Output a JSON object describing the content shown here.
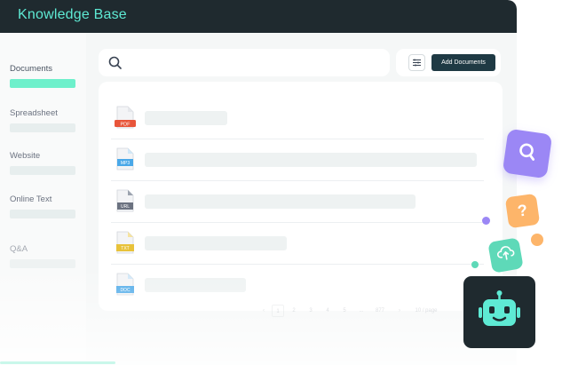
{
  "app": {
    "title": "Knowledge Base"
  },
  "sidebar": {
    "items": [
      {
        "label": "Documents",
        "active": true
      },
      {
        "label": "Spreadsheet",
        "active": false
      },
      {
        "label": "Website",
        "active": false
      },
      {
        "label": "Online Text",
        "active": false
      },
      {
        "label": "Q&A",
        "active": false
      }
    ]
  },
  "search": {
    "icon": "search-icon"
  },
  "toolbar": {
    "filter_icon": "filter-icon",
    "add_label": "Add Documents"
  },
  "documents": [
    {
      "type": "pdf",
      "label": "PDF",
      "color": "#e8553a"
    },
    {
      "type": "mp3",
      "label": "MP3",
      "color": "#4aa8e8"
    },
    {
      "type": "url",
      "label": "URL",
      "color": "#6b7280"
    },
    {
      "type": "txt",
      "label": "TXT",
      "color": "#e8c23a"
    },
    {
      "type": "doc",
      "label": "DOC",
      "color": "#4aa8e8"
    }
  ],
  "pagination": {
    "pages": [
      "1",
      "2",
      "3",
      "4",
      "5",
      "...",
      "877"
    ],
    "per_page": "10 / page"
  },
  "decor": {
    "badges": [
      "search-badge-icon",
      "question-badge-icon",
      "cloud-upload-badge-icon",
      "robot-icon"
    ],
    "colors": {
      "purple": "#9b87f5",
      "orange": "#fdb56a",
      "teal": "#5ed9b8",
      "dark": "#1f2a2f",
      "accent": "#6ef0cb"
    }
  }
}
